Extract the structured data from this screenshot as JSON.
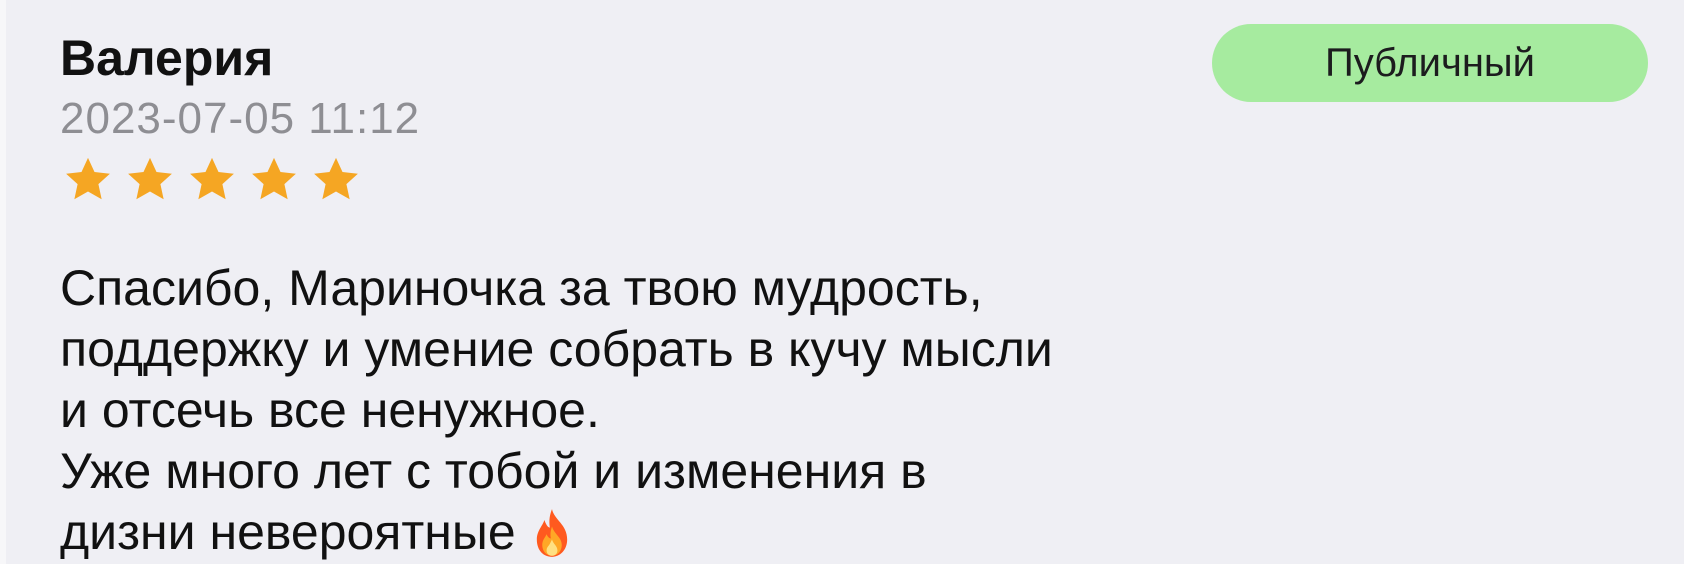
{
  "review": {
    "author": "Валерия",
    "date": "2023-07-05 11:12",
    "rating": 5,
    "rating_max": 5,
    "visibility": "Публичный",
    "text_lines": [
      "Спасибо, Мариночка за твою мудрость,",
      "поддержку и умение собрать в кучу мысли",
      "и отсечь все ненужное.",
      "Уже много лет с тобой и изменения в",
      "дизни невероятные"
    ],
    "emoji_icon": "fire-icon"
  },
  "colors": {
    "background": "#efeff4",
    "star": "#f5a623",
    "badge_background": "#a6eb9f",
    "date_text": "#8e8e93"
  }
}
